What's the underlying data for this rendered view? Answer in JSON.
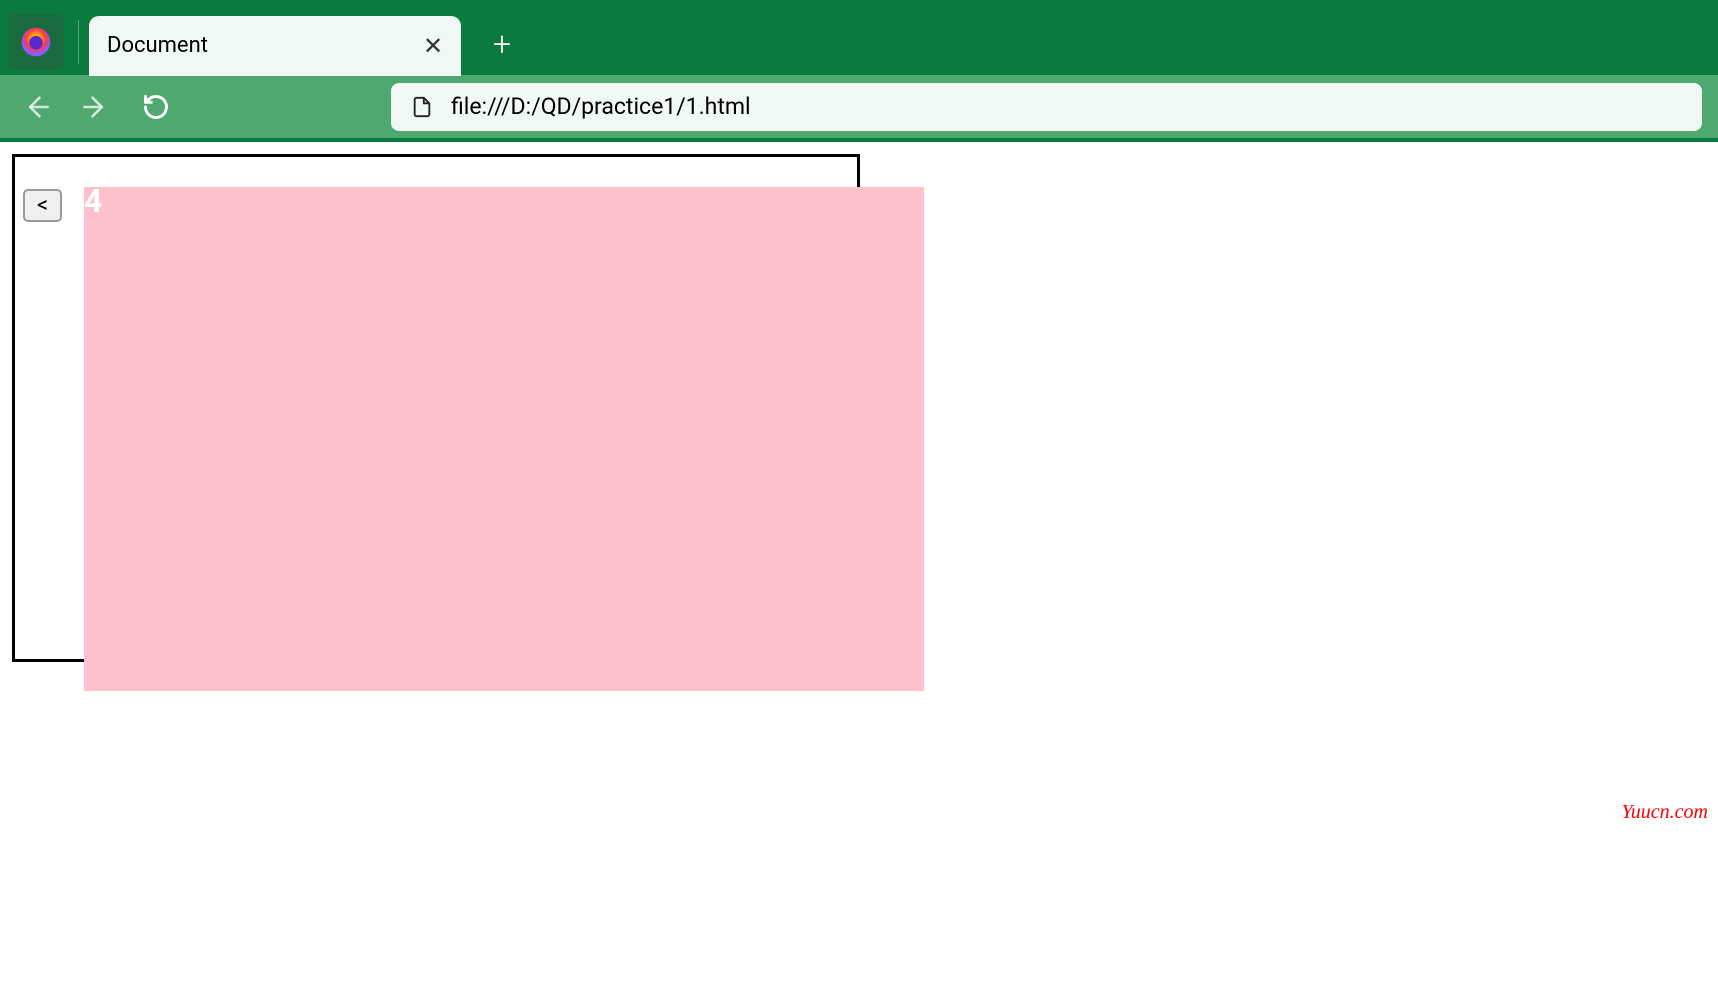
{
  "tab": {
    "title": "Document",
    "close_label": "✕"
  },
  "new_tab_label": "+",
  "url": {
    "text": "file:///D:/QD/practice1/1.html"
  },
  "page": {
    "prev_button": "<",
    "slide_number": "4"
  },
  "watermark": "Yuucn.com"
}
